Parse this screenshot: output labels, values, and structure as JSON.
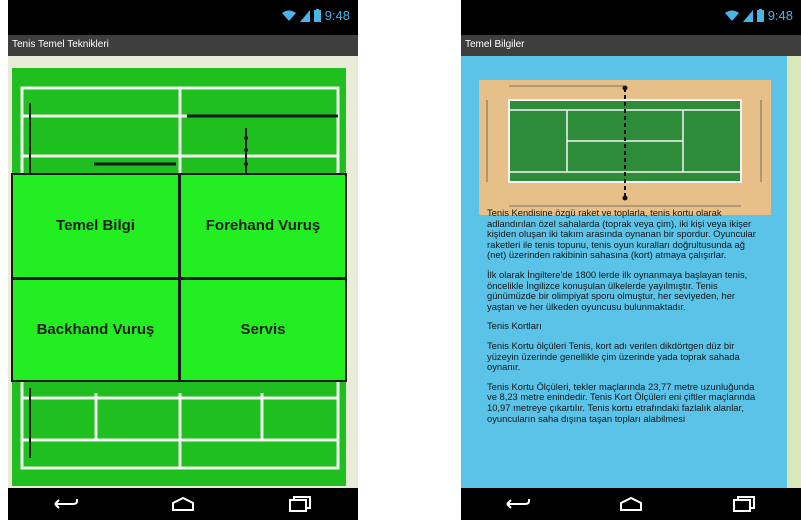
{
  "left_phone": {
    "status": {
      "time": "9:48"
    },
    "appbar": {
      "title": "Tenis Temel Teknikleri"
    },
    "menu": {
      "items": [
        "Temel Bilgi",
        "Forehand Vuruş",
        "Backhand Vuruş",
        "Servis"
      ]
    }
  },
  "right_phone": {
    "status": {
      "time": "9:48"
    },
    "appbar": {
      "title": "Temel Bilgiler"
    },
    "article": {
      "paragraphs": [
        "Tenis Kendisine özgü raket ve toplarla, tenis kortu olarak adlandırılan özel sahalarda (toprak veya çim), iki kişi veya ikişer kişiden oluşan iki takım arasında oynanan bir spordur. Oyuncular raketleri ile tenis topunu, tenis oyun kuralları doğrultusunda ağ (net) üzerinden rakibinin sahasına (kort) atmaya çalışırlar.",
        "İlk olarak İngiltere'de 1800 lerde ilk oynanmaya başlayan tenis, öncelikle İngilizce konuşulan ülkelerde yayılmıştır. Tenis günümüzde bir olimpiyat sporu olmuştur, her seviyeden, her yaştan ve her ülkeden oyuncusu bulunmaktadır.",
        "Tenis Kortları",
        "Tenis Kortu ölçüleri Tenis, kort adı verilen dikdörtgen düz bir yüzeyin üzerinde genellikle çim üzerinde yada toprak sahada oynanır.",
        "Tenis Kortu Ölçüleri, tekler maçlarında 23,77 metre uzunluğunda ve 8,23 metre enindedir. Tenis Kort Ölçüleri eni çiftler maçlarında 10,97 metreye çıkartılır. Tenis kortu etrafındaki fazlalık alanlar, oyuncuların saha dışına taşan topları alabilmesi"
      ]
    }
  },
  "colors": {
    "court_green": "#1fbf1f",
    "button_green": "#22ee22",
    "article_bg": "#5bc3e8",
    "status_icon": "#4ab3e8"
  },
  "icons": [
    "wifi-icon",
    "signal-icon",
    "battery-icon",
    "back-icon",
    "home-icon",
    "recents-icon"
  ]
}
